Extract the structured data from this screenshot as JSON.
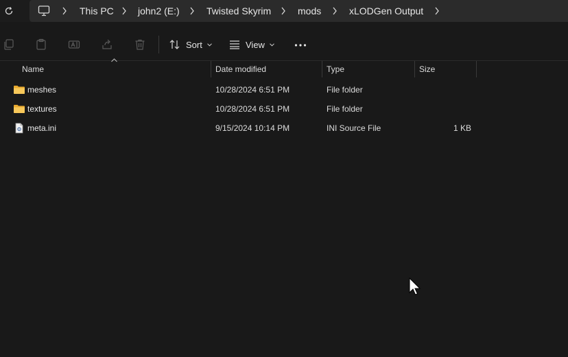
{
  "breadcrumb": {
    "items": [
      "This PC",
      "john2 (E:)",
      "Twisted Skyrim",
      "mods",
      "xLODGen Output"
    ]
  },
  "toolbar": {
    "sort_label": "Sort",
    "view_label": "View"
  },
  "columns": {
    "name": "Name",
    "date": "Date modified",
    "type": "Type",
    "size": "Size"
  },
  "files": [
    {
      "name": "meshes",
      "date": "10/28/2024 6:51 PM",
      "type": "File folder",
      "size": "",
      "icon": "folder-icon"
    },
    {
      "name": "textures",
      "date": "10/28/2024 6:51 PM",
      "type": "File folder",
      "size": "",
      "icon": "folder-icon"
    },
    {
      "name": "meta.ini",
      "date": "9/15/2024 10:14 PM",
      "type": "INI Source File",
      "size": "1 KB",
      "icon": "ini-file-icon"
    }
  ],
  "colors": {
    "background": "#191919",
    "address_bar": "#2b2b2b",
    "folder": "#f5c04a"
  }
}
